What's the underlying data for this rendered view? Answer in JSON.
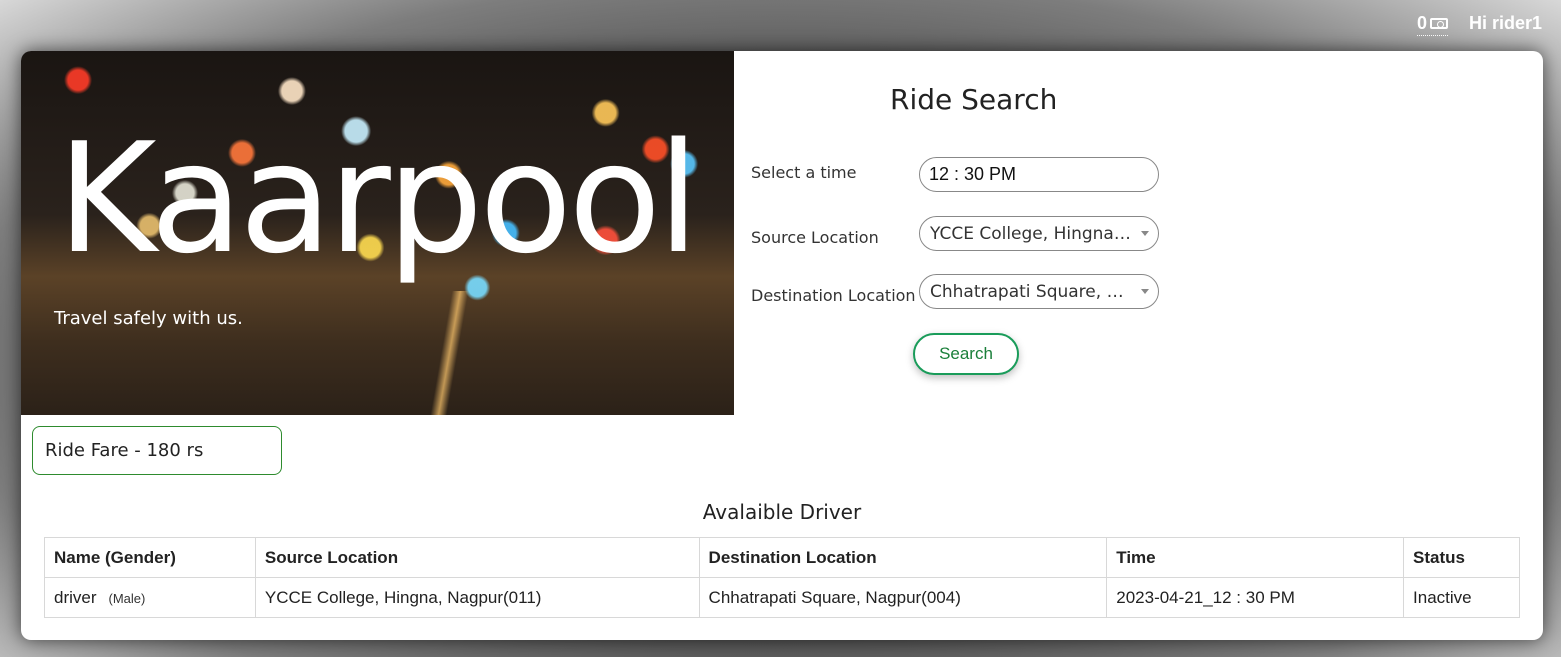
{
  "header": {
    "wallet_amount": "0",
    "greeting": "Hi rider1"
  },
  "hero": {
    "brand": "Kaarpool",
    "tagline": "Travel safely with us."
  },
  "search_form": {
    "title": "Ride Search",
    "time_label": "Select a time",
    "time_value": "12 : 30 PM",
    "source_label": "Source Location",
    "source_value": "YCCE College, Hingna, Nagpur(011)",
    "destination_label": "Destination Location",
    "destination_value": "Chhatrapati Square, Nagpur(004)",
    "search_button": "Search"
  },
  "fare": {
    "text": "Ride Fare - 180 rs"
  },
  "drivers_table": {
    "title": "Avalaible Driver",
    "columns": [
      "Name (Gender)",
      "Source Location",
      "Destination Location",
      "Time",
      "Status"
    ],
    "rows": [
      {
        "name": "driver",
        "gender": "(Male)",
        "source": "YCCE College, Hingna, Nagpur(011)",
        "destination": "Chhatrapati Square, Nagpur(004)",
        "time": "2023-04-21_12 : 30 PM",
        "status": "Inactive"
      }
    ]
  }
}
